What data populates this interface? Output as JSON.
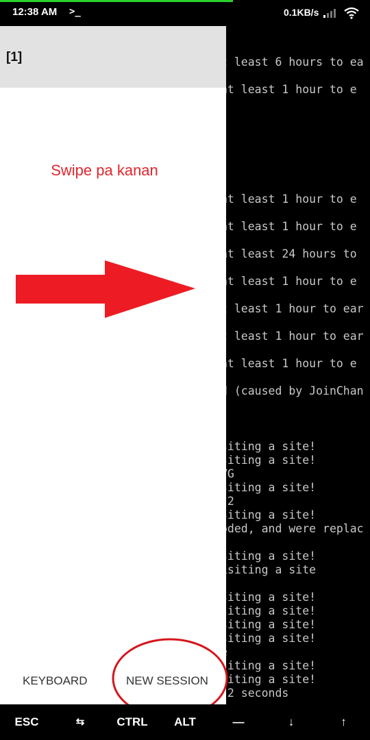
{
  "status_bar": {
    "time": "12:38 AM",
    "prompt_icon": ">_",
    "net_speed": "0.1KB/s",
    "signal_icon": "signal-icon",
    "wifi_icon": "wifi-icon"
  },
  "terminal": {
    "lines": [
      "t least 6 hours to ea",
      "at least 1 hour to e",
      "at least 1 hour to e",
      "at least 1 hour to e",
      "at least 24 hours to",
      "at least 1 hour to e",
      "t least 1 hour to ear",
      "t least 1 hour to ear",
      "at least 1 hour to e",
      "d (caused by JoinChan",
      "siting a site!",
      "siting a site!",
      "VG",
      "siting a site!",
      "J2",
      "siting a site!",
      "oded, and were replac",
      "siting a site!",
      "isiting a site",
      "siting a site!",
      "siting a site!",
      "siting a site!",
      "siting a site!",
      "e",
      "siting a site!",
      "siting a site!",
      " 2 seconds"
    ]
  },
  "drawer": {
    "session_label": "[1]",
    "swipe_hint": "Swipe pa kanan",
    "keyboard_button": "KEYBOARD",
    "new_session_button": "NEW SESSION",
    "accent_color": "#e0262c"
  },
  "extra_keys": {
    "esc": "ESC",
    "tab": "⇆",
    "ctrl": "CTRL",
    "alt": "ALT",
    "dash": "—",
    "down": "↓",
    "up": "↑"
  }
}
